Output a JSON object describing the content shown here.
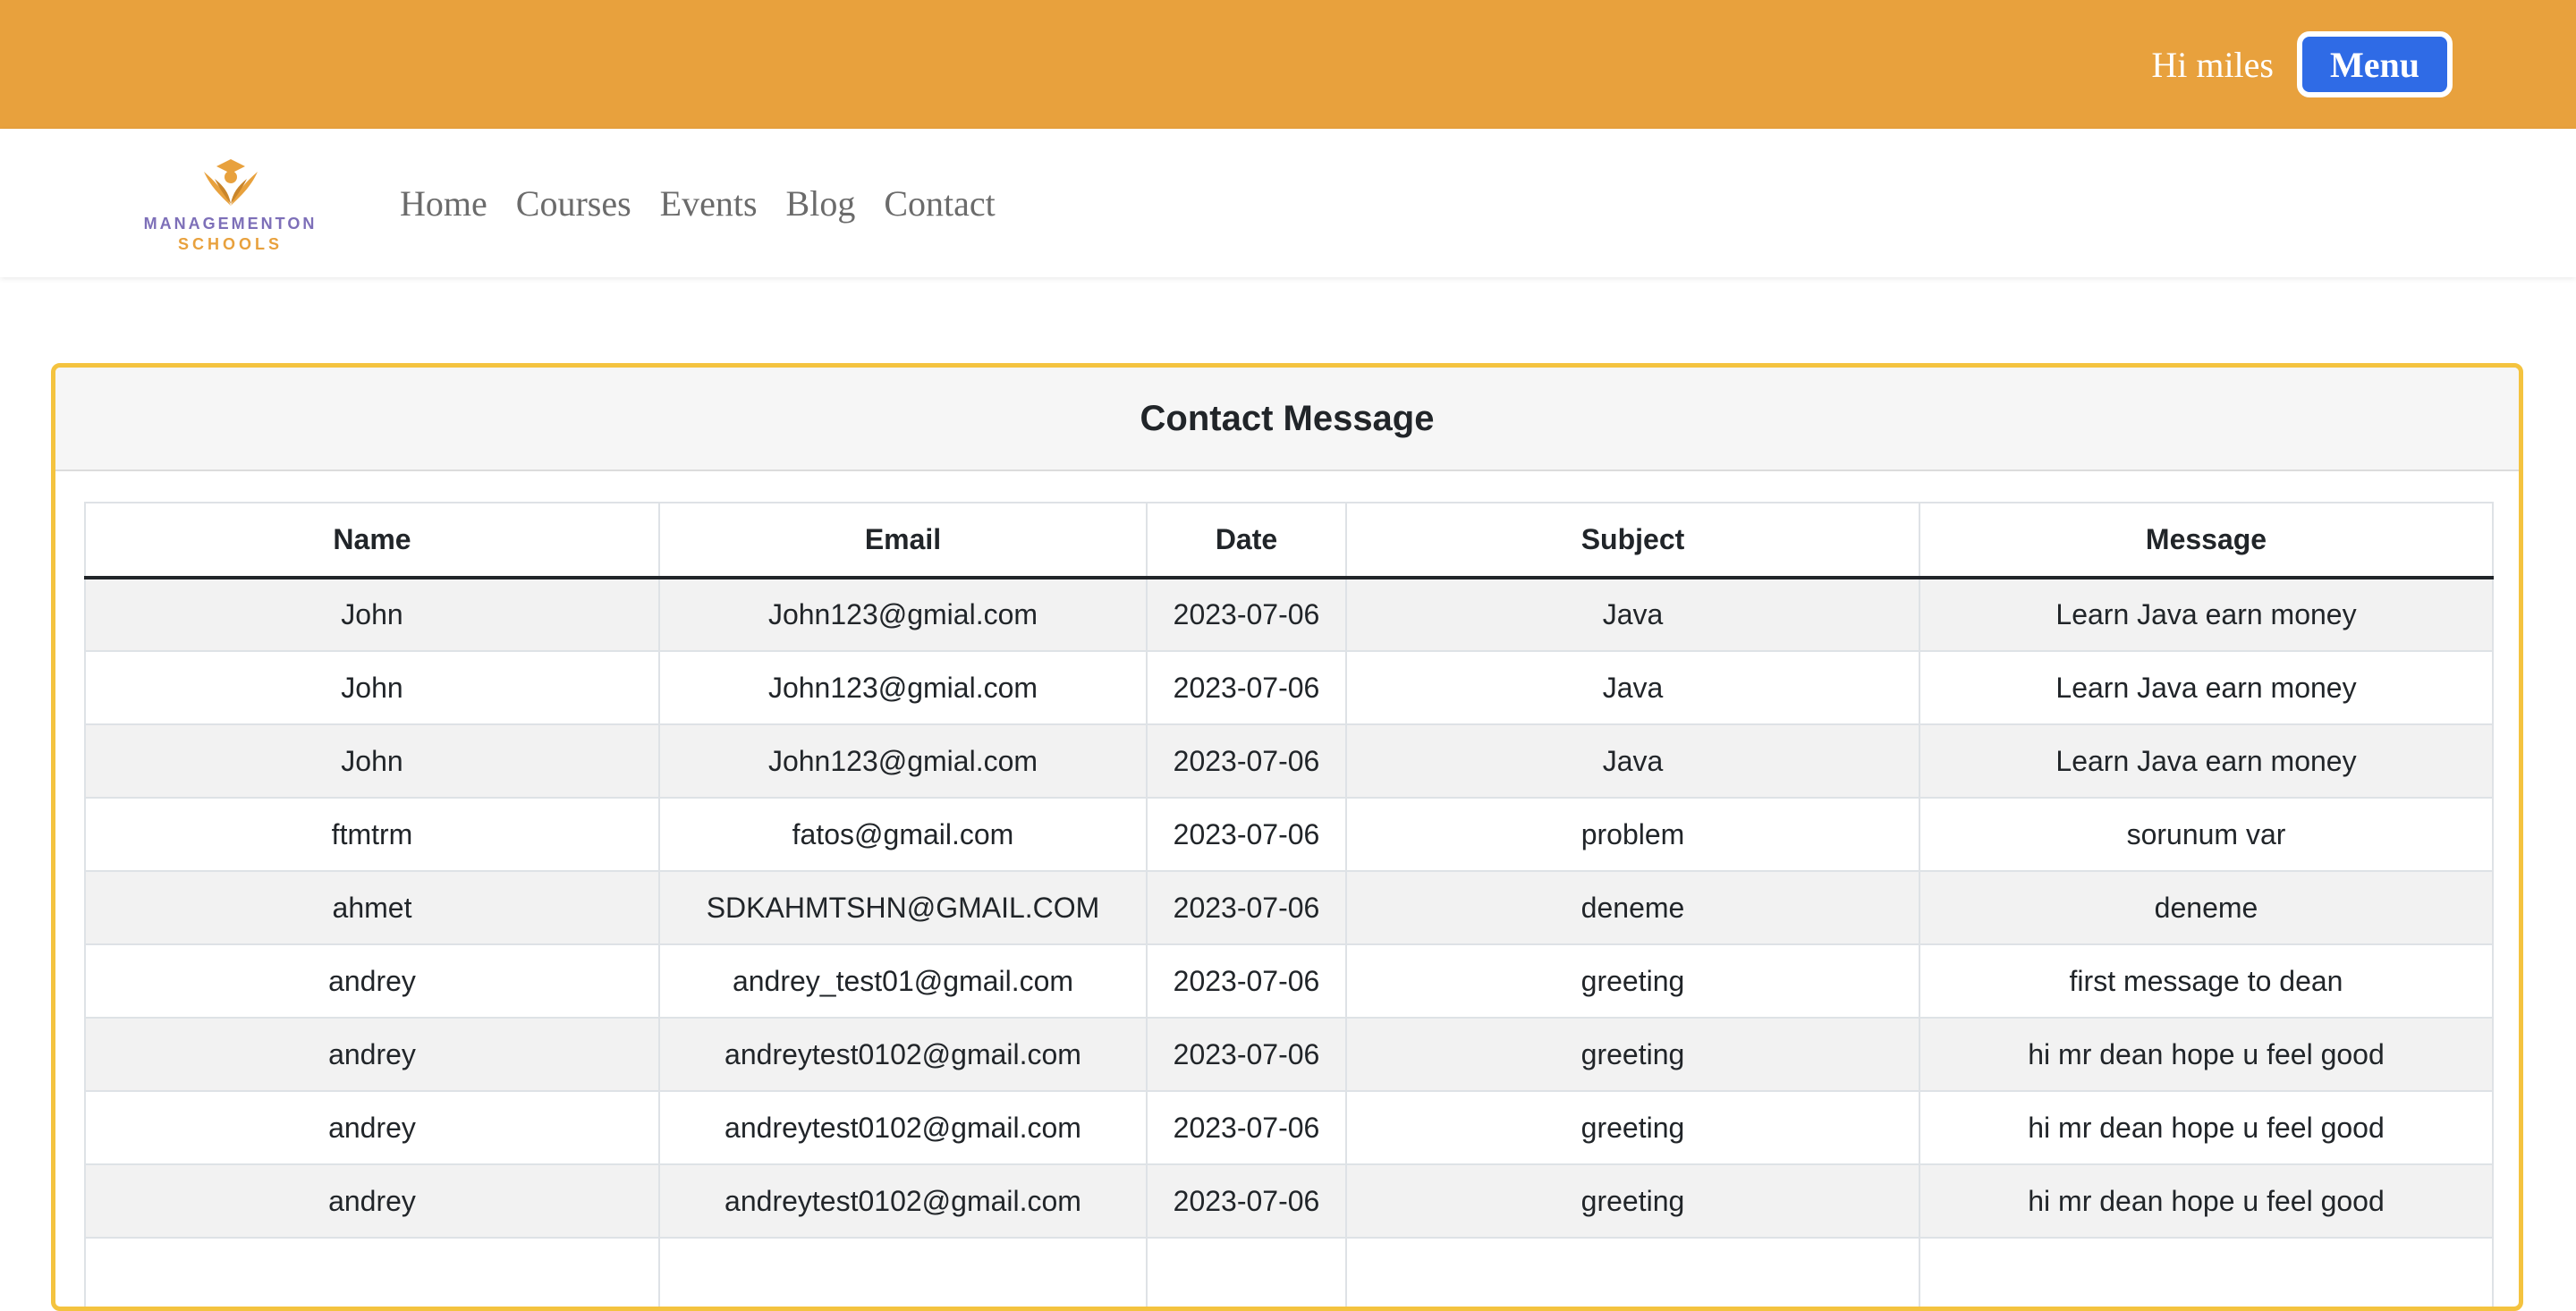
{
  "topbar": {
    "greeting": "Hi miles",
    "menu_label": "Menu",
    "bg_color": "#e8a13d",
    "menu_color": "#2f6be6"
  },
  "brand": {
    "line1": "MANAGEMENTON",
    "line2": "SCHOOLS"
  },
  "nav": {
    "items": [
      {
        "label": "Home"
      },
      {
        "label": "Courses"
      },
      {
        "label": "Events"
      },
      {
        "label": "Blog"
      },
      {
        "label": "Contact"
      }
    ]
  },
  "card": {
    "title": "Contact Message",
    "border_color": "#f4c33f"
  },
  "table": {
    "columns": [
      "Name",
      "Email",
      "Date",
      "Subject",
      "Message"
    ],
    "rows": [
      [
        "John",
        "John123@gmial.com",
        "2023-07-06",
        "Java",
        "Learn Java earn money"
      ],
      [
        "John",
        "John123@gmial.com",
        "2023-07-06",
        "Java",
        "Learn Java earn money"
      ],
      [
        "John",
        "John123@gmial.com",
        "2023-07-06",
        "Java",
        "Learn Java earn money"
      ],
      [
        "ftmtrm",
        "fatos@gmail.com",
        "2023-07-06",
        "problem",
        "sorunum var"
      ],
      [
        "ahmet",
        "SDKAHMTSHN@GMAIL.COM",
        "2023-07-06",
        "deneme",
        "deneme"
      ],
      [
        "andrey",
        "andrey_test01@gmail.com",
        "2023-07-06",
        "greeting",
        "first message to dean"
      ],
      [
        "andrey",
        "andreytest0102@gmail.com",
        "2023-07-06",
        "greeting",
        "hi mr dean hope u feel good"
      ],
      [
        "andrey",
        "andreytest0102@gmail.com",
        "2023-07-06",
        "greeting",
        "hi mr dean hope u feel good"
      ],
      [
        "andrey",
        "andreytest0102@gmail.com",
        "2023-07-06",
        "greeting",
        "hi mr dean hope u feel good"
      ],
      [
        "",
        "",
        "",
        "",
        ""
      ]
    ]
  }
}
